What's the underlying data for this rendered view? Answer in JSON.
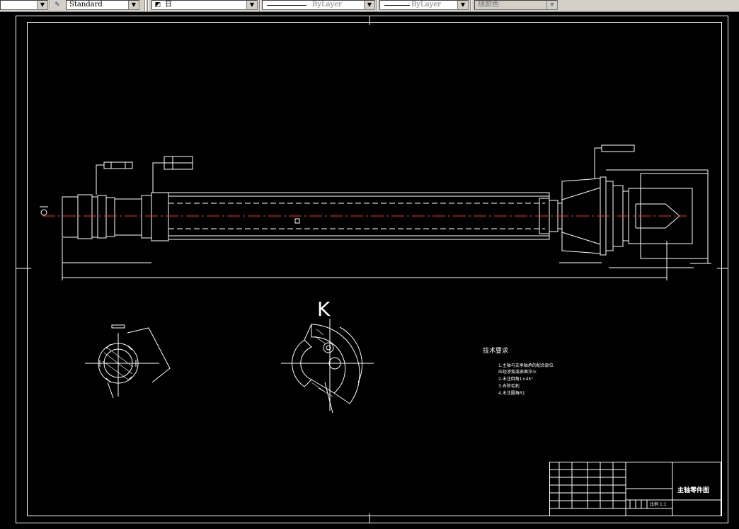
{
  "toolbar": {
    "text_style": "Standard",
    "layer_name": "日",
    "linetype": "ByLayer",
    "lineweight": "ByLayer",
    "color": "随颜色",
    "icons": [
      "dropdown-arrow",
      "text-style-icon",
      "layer-state-icon"
    ]
  },
  "drawing": {
    "view_label": "K",
    "tech_requirements": {
      "title": "技术要求",
      "items": [
        "1.主轴与支承轴承的配合部位",
        "   应经渗氮或表面淬火",
        "2.未注倒角1×45°",
        "3.去除毛刺",
        "4.未注圆角R1"
      ]
    },
    "title_block": {
      "part_name": "主轴零件图",
      "scale_text": "比例 1:1"
    },
    "colors": {
      "background": "#000000",
      "lines": "#ffffff",
      "center_line": "#ff3030"
    }
  }
}
